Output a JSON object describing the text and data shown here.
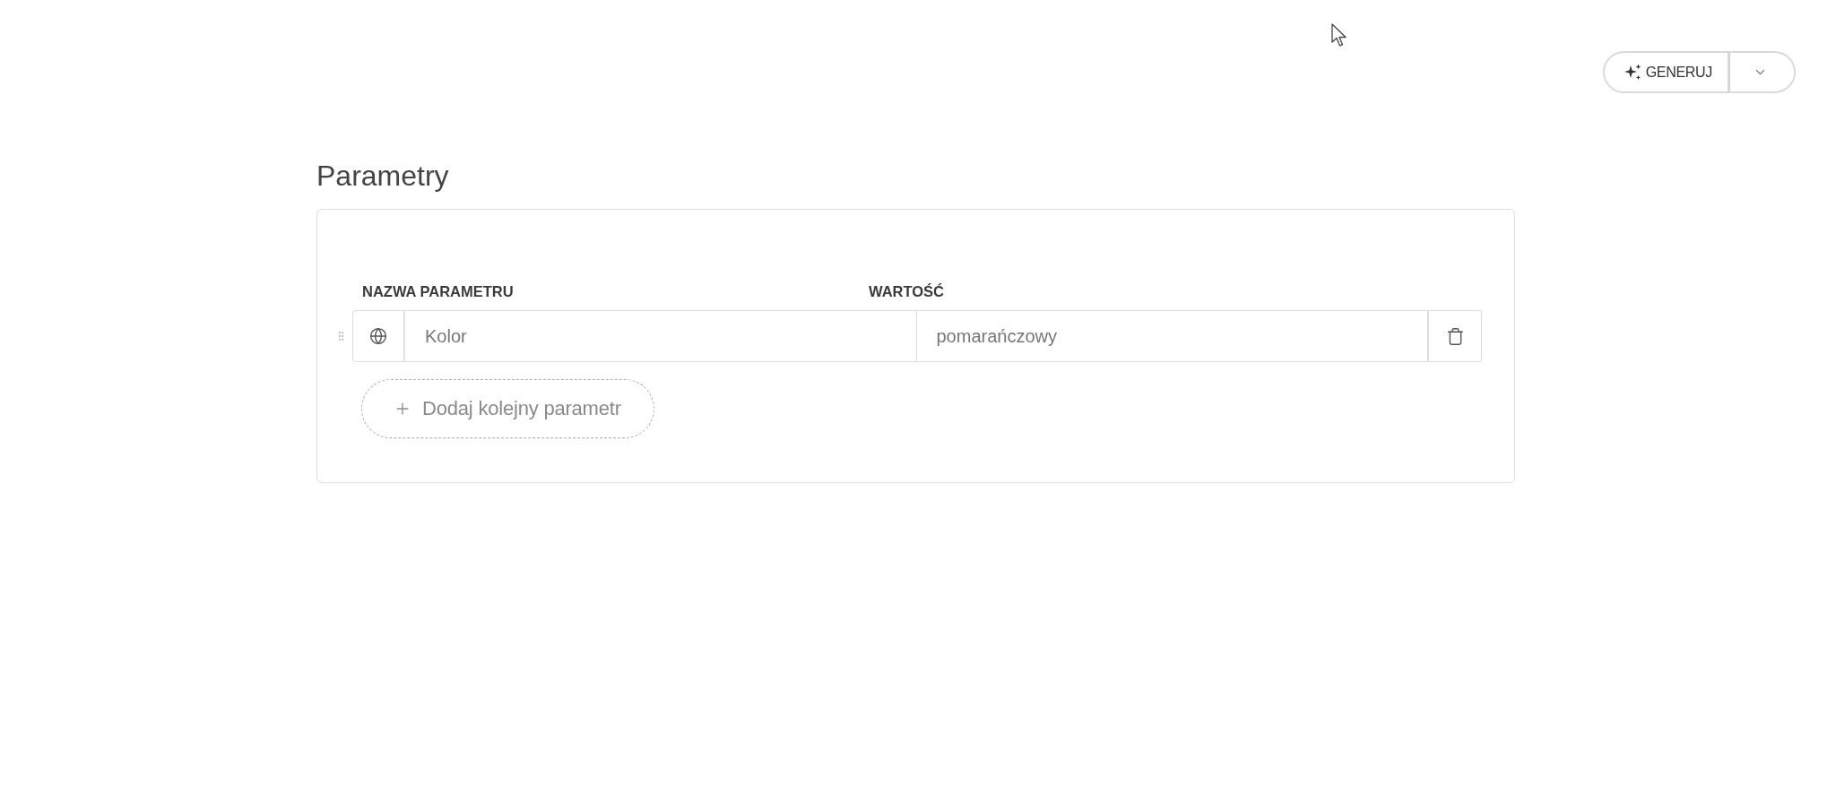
{
  "toolbar": {
    "generate_button": {
      "label": "GENERUJ"
    }
  },
  "section": {
    "title": "Parametry",
    "columns": [
      "NAZWA PARAMETRU",
      "WARTOŚĆ"
    ],
    "parameters": [
      {
        "name": "Kolor",
        "value": "pomarańczowy"
      }
    ],
    "add_button": {
      "label": "Dodaj kolejny parametr"
    }
  }
}
